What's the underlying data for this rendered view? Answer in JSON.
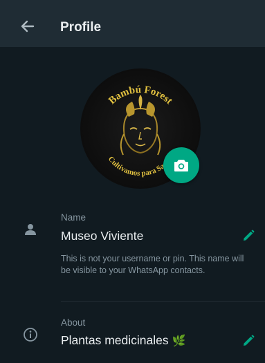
{
  "header": {
    "title": "Profile",
    "back_icon": "arrow-left-icon"
  },
  "avatar": {
    "logo_text_top": "Bambú Forest",
    "logo_text_bottom": "Cultivamos para Sanar"
  },
  "name_row": {
    "icon": "person-icon",
    "label": "Name",
    "value": "Museo Viviente",
    "hint": "This is not your username or pin. This name will be visible to your WhatsApp contacts.",
    "edit_icon": "pencil-icon"
  },
  "about_row": {
    "icon": "info-icon",
    "label": "About",
    "value": "Plantas medicinales",
    "emoji": "🌿",
    "edit_icon": "pencil-icon"
  },
  "colors": {
    "background": "#111b21",
    "header": "#1f2c34",
    "accent": "#00a884",
    "text_primary": "#e9edef",
    "text_secondary": "#8696a0"
  }
}
